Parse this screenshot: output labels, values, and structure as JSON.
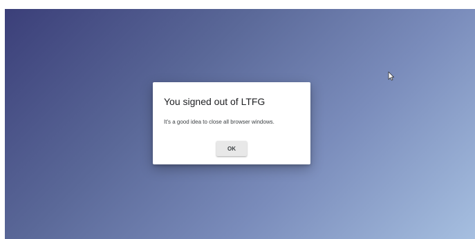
{
  "dialog": {
    "title": "You signed out of LTFG",
    "message": "It's a good idea to close all browser windows.",
    "ok_label": "OK"
  },
  "colors": {
    "background_gradient_start": "#3b3f79",
    "background_gradient_end": "#a6bfe0",
    "dialog_background": "#ffffff",
    "button_background": "#e8e8e8"
  },
  "icons": {
    "cursor": "mouse-pointer-icon"
  }
}
